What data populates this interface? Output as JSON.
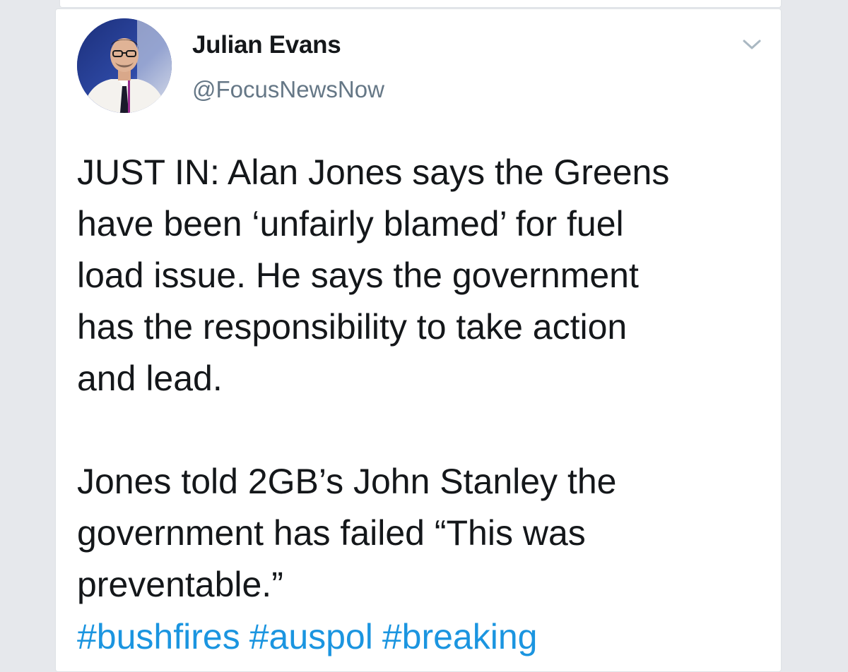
{
  "tweet": {
    "author": {
      "display_name": "Julian Evans",
      "handle": "@FocusNewsNow"
    },
    "icons": {
      "menu": "chevron-down-icon",
      "avatar": "profile-photo"
    },
    "body": {
      "paragraph_1": [
        "JUST IN: Alan Jones says the Greens",
        "have been ‘unfairly blamed’ for fuel",
        "load issue. He says the government",
        "has the responsibility to take action",
        "and lead."
      ],
      "paragraph_2": [
        "Jones told 2GB’s John Stanley the",
        "government has failed “This was",
        "preventable.”"
      ]
    },
    "hashtags": [
      "#bushfires",
      "#auspol",
      "#breaking"
    ],
    "colors": {
      "text": "#14171a",
      "secondary": "#657786",
      "link": "#1b95e0",
      "background": "#e6e8ec"
    }
  }
}
